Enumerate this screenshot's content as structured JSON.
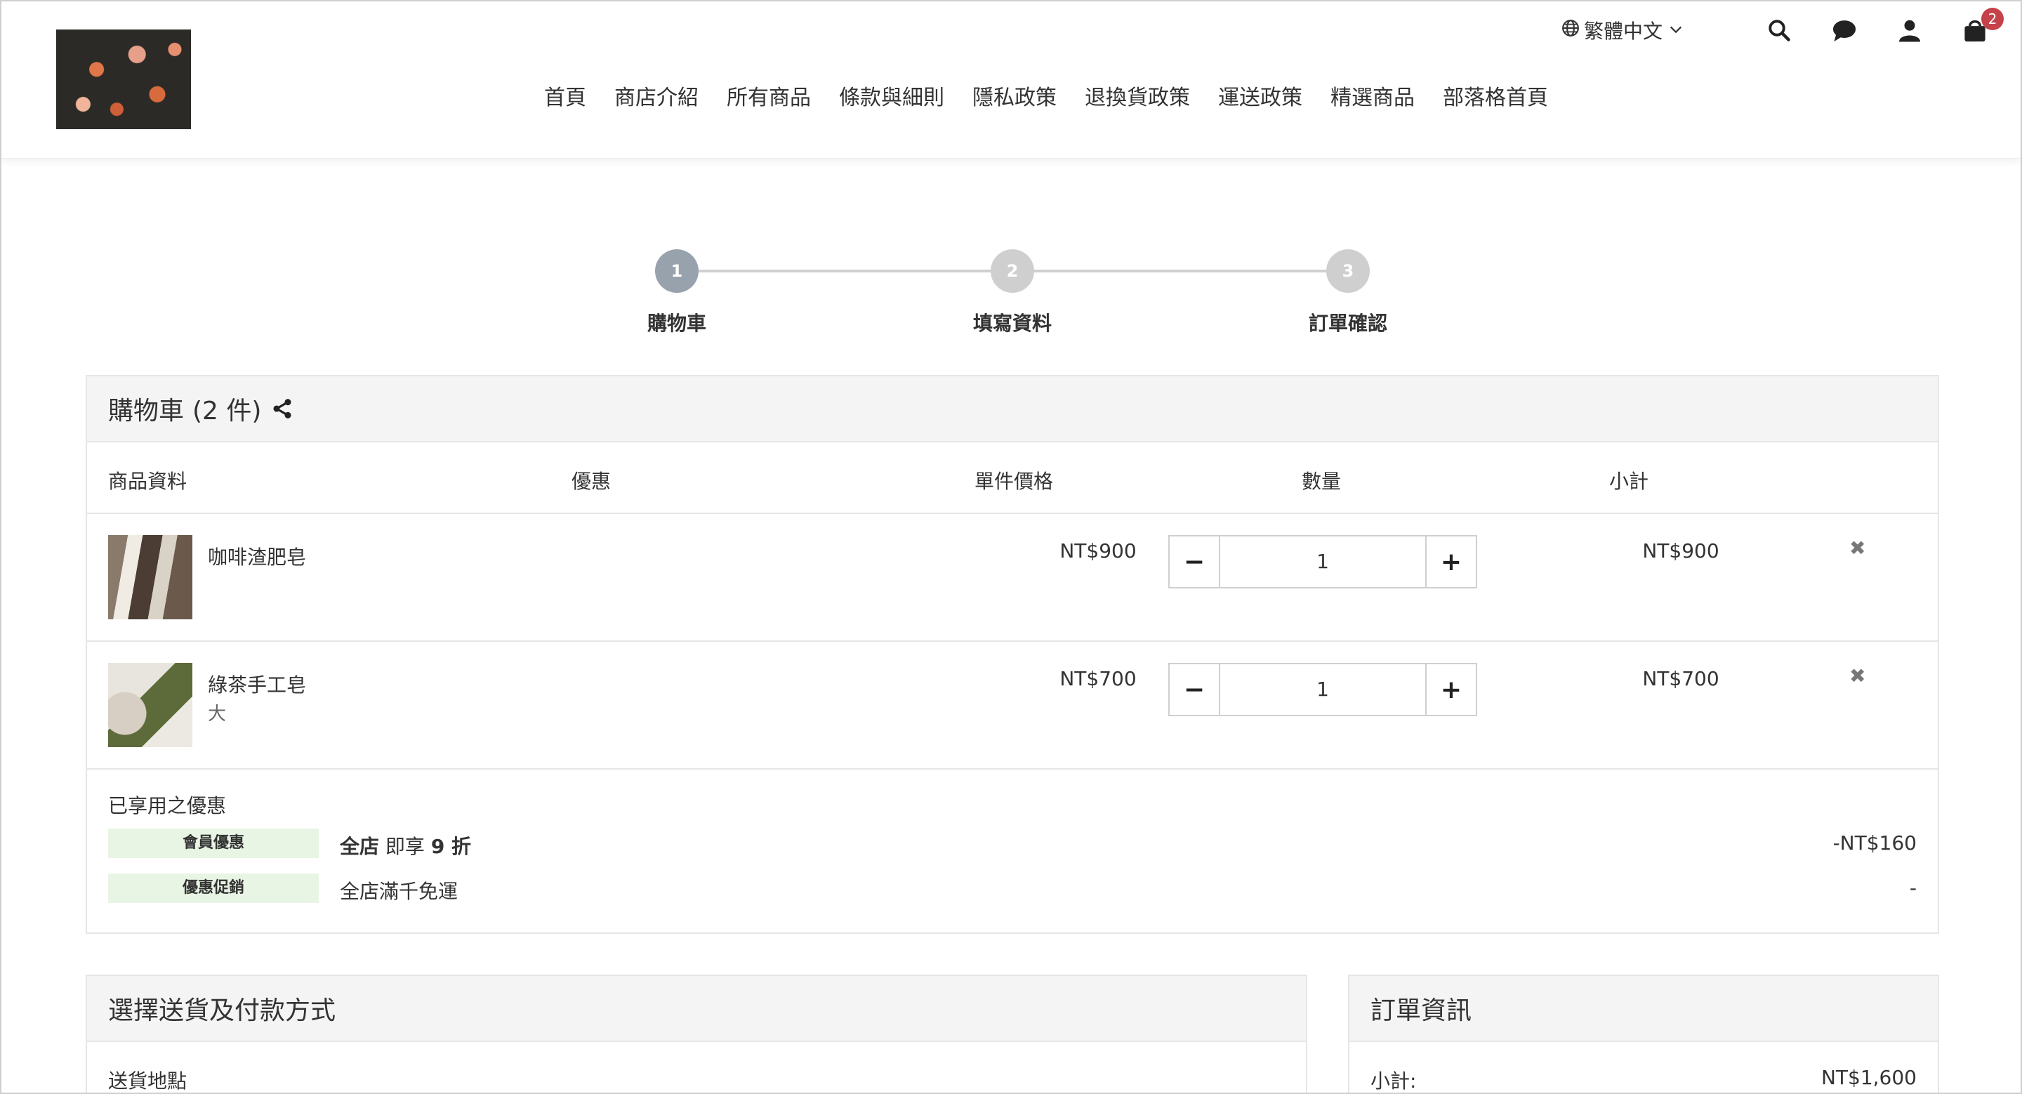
{
  "header": {
    "logo_alt": "",
    "language": "繁體中文",
    "cart_count": "2",
    "icons": [
      "globe-icon",
      "chevron-down-icon",
      "search-icon",
      "chat-icon",
      "user-icon",
      "cart-icon"
    ],
    "nav": [
      "首頁",
      "商店介紹",
      "所有商品",
      "條款與細則",
      "隱私政策",
      "退換貨政策",
      "運送政策",
      "精選商品",
      "部落格首頁"
    ]
  },
  "steps": [
    {
      "num": "1",
      "label": "購物車",
      "active": true
    },
    {
      "num": "2",
      "label": "填寫資料",
      "active": false
    },
    {
      "num": "3",
      "label": "訂單確認",
      "active": false
    }
  ],
  "cart": {
    "title": "購物車",
    "count_text": "(2 件)",
    "columns": {
      "product": "商品資料",
      "discount": "優惠",
      "unit_price": "單件價格",
      "quantity": "數量",
      "subtotal": "小計"
    },
    "items": [
      {
        "name": "咖啡渣肥皂",
        "variant": "",
        "price": "NT$900",
        "qty": "1",
        "subtotal": "NT$900"
      },
      {
        "name": "綠茶手工皂",
        "variant": "大",
        "price": "NT$700",
        "qty": "1",
        "subtotal": "NT$700"
      }
    ],
    "qty_minus": "−",
    "qty_plus": "+",
    "remove_symbol": "✖",
    "promotions": {
      "title": "已享用之優惠",
      "lines": [
        {
          "tag": "會員優惠",
          "text_bold": "全店",
          "text_mid": " 即享 ",
          "text_bold2": "9 折",
          "amount": "-NT$160"
        },
        {
          "tag": "優惠促銷",
          "text": "全店滿千免運",
          "amount": "-"
        }
      ]
    }
  },
  "shipping": {
    "title": "選擇送貨及付款方式",
    "address_label": "送貨地點"
  },
  "order_info": {
    "title": "訂單資訊",
    "subtotal_label": "小計:",
    "subtotal_value": "NT$1,600"
  },
  "colors": {
    "step_active": "#98a2ad",
    "step_inactive": "#cfcfcf",
    "badge": "#c5424a",
    "promo_tag_bg": "#e8f5e4",
    "panel_head_bg": "#f4f4f4"
  }
}
